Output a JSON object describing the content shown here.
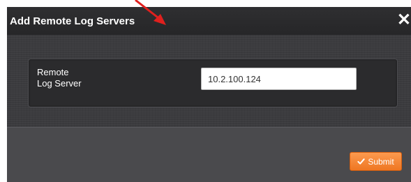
{
  "dialog": {
    "title": "Add Remote Log Servers",
    "close_label": "✕"
  },
  "form": {
    "field_label_line1": "Remote",
    "field_label_line2": "Log Server",
    "field_value": "10.2.100.124"
  },
  "footer": {
    "submit_label": "Submit",
    "submit_icon": "check-icon"
  },
  "colors": {
    "accent": "#f0802a",
    "annotation_arrow": "#e0201e"
  }
}
